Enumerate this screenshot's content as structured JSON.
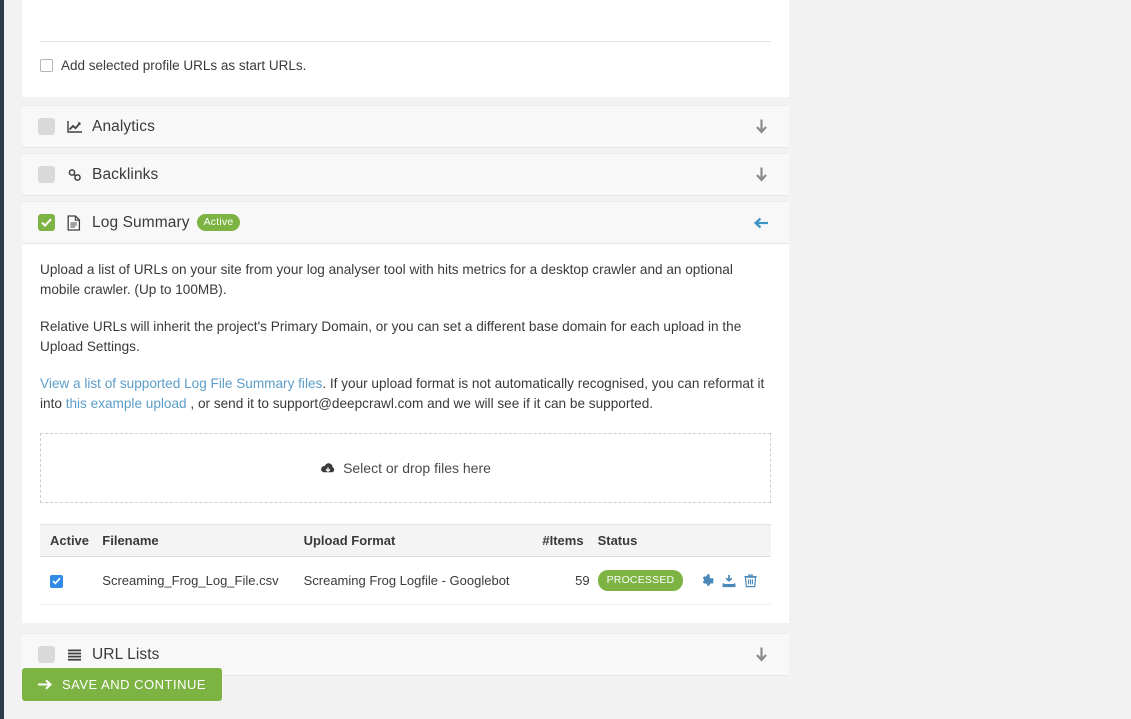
{
  "colors": {
    "green": "#7cb342",
    "link_blue": "#5b9dc8",
    "toggle_blue": "#3d93c6",
    "action_blue": "#4a89b8",
    "checkbox_blue": "#2f8ae8",
    "page_bg": "#f2f2f2",
    "rail": "#2f3a4a"
  },
  "top_panel": {
    "checkbox_label": "Add selected profile URLs as start URLs.",
    "checkbox_checked": false,
    "checkbox_icon": "checkbox-unchecked-icon"
  },
  "sections": [
    {
      "id": "analytics",
      "label": "Analytics",
      "icon": "line-chart-icon",
      "checked": false,
      "expanded": false,
      "toggle_icon": "arrow-down-icon"
    },
    {
      "id": "backlinks",
      "label": "Backlinks",
      "icon": "link-chain-icon",
      "checked": false,
      "expanded": false,
      "toggle_icon": "arrow-down-icon"
    },
    {
      "id": "log-summary",
      "label": "Log Summary",
      "icon": "file-document-icon",
      "badge": "Active",
      "checked": true,
      "expanded": true,
      "toggle_icon": "arrow-left-icon"
    },
    {
      "id": "url-lists",
      "label": "URL Lists",
      "icon": "list-icon",
      "checked": false,
      "expanded": false,
      "toggle_icon": "arrow-down-icon"
    }
  ],
  "log_summary": {
    "paragraph_1": "Upload a list of URLs on your site from your log analyser tool with hits metrics for a desktop crawler and an optional mobile crawler. (Up to 100MB).",
    "paragraph_2": "Relative URLs will inherit the project's Primary Domain, or you can set a different base domain for each upload in the Upload Settings.",
    "link_supported": "View a list of supported Log File Summary files",
    "paragraph_3_mid": ". If your upload format is not automatically recognised, you can reformat it into ",
    "link_example": "this example upload",
    "paragraph_3_end": " , or send it to support@deepcrawl.com and we will see if it can be supported.",
    "dropzone_label": "Select or drop files here",
    "dropzone_icon": "cloud-upload-icon",
    "table": {
      "columns": [
        "Active",
        "Filename",
        "Upload Format",
        "#Items",
        "Status",
        ""
      ],
      "rows": [
        {
          "active": true,
          "filename": "Screaming_Frog_Log_File.csv",
          "upload_format": "Screaming Frog Logfile - Googlebot",
          "items": "59",
          "status": "PROCESSED",
          "actions": [
            "gear-icon",
            "download-icon",
            "trash-icon"
          ]
        }
      ]
    }
  },
  "footer": {
    "save_label": "SAVE AND CONTINUE",
    "save_icon": "arrow-right-icon"
  }
}
